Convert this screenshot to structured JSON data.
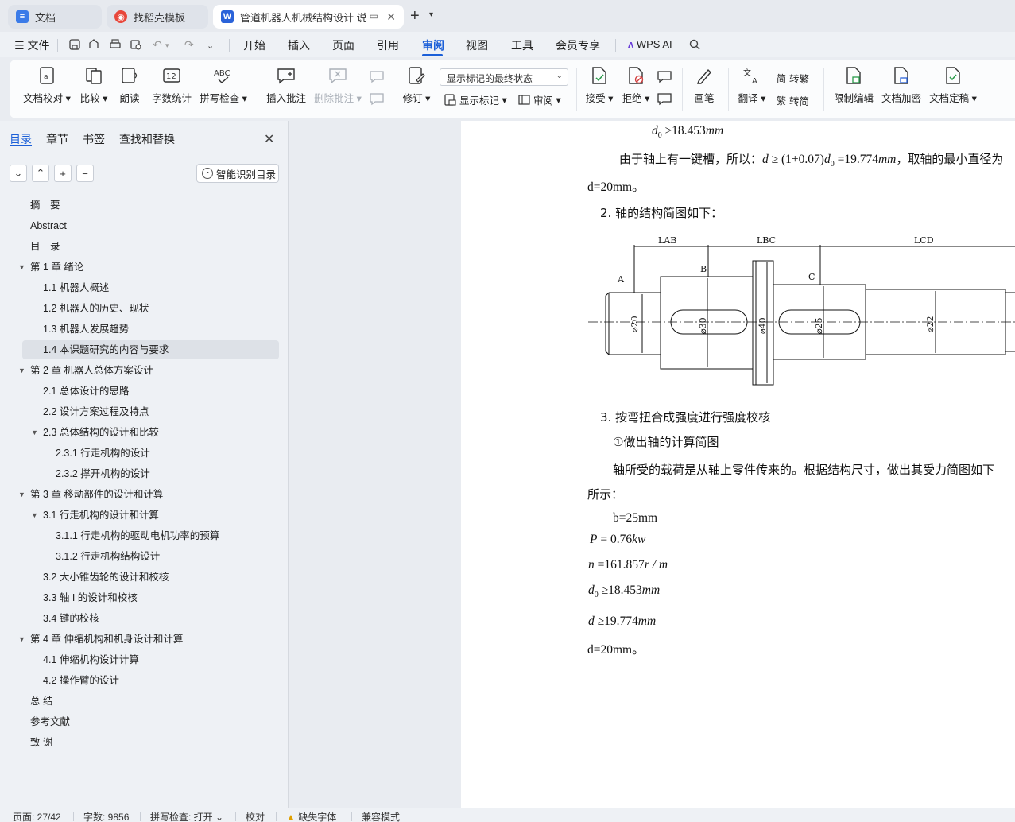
{
  "tabs": [
    {
      "label": "文档",
      "icon": "docs-icon",
      "color": "#3b7be8"
    },
    {
      "label": "找稻壳模板",
      "icon": "docer-icon",
      "color": "#e8473b"
    },
    {
      "label": "管道机器人机械结构设计 说明",
      "icon": "word-icon",
      "color": "#2b63d9"
    }
  ],
  "menu": {
    "file": "文件",
    "items": [
      "开始",
      "插入",
      "页面",
      "引用",
      "审阅",
      "视图",
      "工具",
      "会员专享"
    ],
    "active": "审阅",
    "wps_ai": "WPS AI"
  },
  "ribbon": {
    "proofread": "文档校对",
    "compare": "比较",
    "read_aloud": "朗读",
    "word_count": "字数统计",
    "spell_check": "拼写检查",
    "insert_comment": "插入批注",
    "delete_comment": "删除批注",
    "revise": "修订",
    "markup_state": "显示标记的最终状态",
    "show_markup": "显示标记",
    "review": "审阅",
    "accept": "接受",
    "reject": "拒绝",
    "ink": "画笔",
    "translate": "翻译",
    "to_traditional": "转繁",
    "to_simplified": "转简",
    "restrict_edit": "限制编辑",
    "encrypt": "文档加密",
    "finalize": "文档定稿"
  },
  "nav": {
    "tabs": [
      "目录",
      "章节",
      "书签",
      "查找和替换"
    ],
    "smart_button": "智能识别目录",
    "toc": [
      {
        "label": "摘　要",
        "level": 0,
        "arrow": false
      },
      {
        "label": "Abstract",
        "level": 0,
        "arrow": false
      },
      {
        "label": "目　录",
        "level": 0,
        "arrow": false
      },
      {
        "label": "第 1 章  绪论",
        "level": 0,
        "arrow": true
      },
      {
        "label": "1.1  机器人概述",
        "level": 1,
        "arrow": false
      },
      {
        "label": "1.2  机器人的历史、现状",
        "level": 1,
        "arrow": false
      },
      {
        "label": "1.3 机器人发展趋势",
        "level": 1,
        "arrow": false
      },
      {
        "label": "1.4  本课题研究的内容与要求",
        "level": 1,
        "arrow": false,
        "selected": true
      },
      {
        "label": "第 2 章  机器人总体方案设计",
        "level": 0,
        "arrow": true
      },
      {
        "label": "2.1 总体设计的思路",
        "level": 1,
        "arrow": false
      },
      {
        "label": "2.2  设计方案过程及特点",
        "level": 1,
        "arrow": false
      },
      {
        "label": "2.3  总体结构的设计和比较",
        "level": 1,
        "arrow": true
      },
      {
        "label": "2.3.1  行走机构的设计",
        "level": 2,
        "arrow": false
      },
      {
        "label": "2.3.2  撑开机构的设计",
        "level": 2,
        "arrow": false
      },
      {
        "label": "第 3 章  移动部件的设计和计算",
        "level": 0,
        "arrow": true
      },
      {
        "label": "3.1  行走机构的设计和计算",
        "level": 1,
        "arrow": true
      },
      {
        "label": "3.1.1  行走机构的驱动电机功率的预算",
        "level": 2,
        "arrow": false
      },
      {
        "label": "3.1.2  行走机构结构设计",
        "level": 2,
        "arrow": false
      },
      {
        "label": "3.2 大小锥齿轮的设计和校核",
        "level": 1,
        "arrow": false
      },
      {
        "label": "3.3  轴 I 的设计和校核",
        "level": 1,
        "arrow": false
      },
      {
        "label": "3.4  键的校核",
        "level": 1,
        "arrow": false
      },
      {
        "label": "第 4 章  伸缩机构和机身设计和计算",
        "level": 0,
        "arrow": true
      },
      {
        "label": "4.1  伸缩机构设计计算",
        "level": 1,
        "arrow": false
      },
      {
        "label": "4.2  操作臂的设计",
        "level": 1,
        "arrow": false
      },
      {
        "label": "总 结",
        "level": 0,
        "arrow": false
      },
      {
        "label": "参考文献",
        "level": 0,
        "arrow": false
      },
      {
        "label": "致 谢",
        "level": 0,
        "arrow": false
      }
    ]
  },
  "doc": {
    "line_d0": "≥18.453",
    "line_keyway_pre": "由于轴上有一键槽，所以：",
    "line_keyway_formula_a": "≥ (1+0.07)",
    "line_keyway_formula_b": "=19.774",
    "line_keyway_post": "，取轴的最小直径为",
    "line_d20": "d=20mm。",
    "item2": "2.  轴的结构简图如下：",
    "diagram": {
      "labels_top": [
        "LAB",
        "LBC",
        "LCD"
      ],
      "points": [
        "A",
        "B",
        "C"
      ],
      "diameters": [
        "⌀20",
        "⌀30",
        "⌀40",
        "⌀25",
        "⌀22"
      ]
    },
    "item3": "3.  按弯扭合成强度进行强度校核",
    "sub1": "①做出轴的计算简图",
    "para1": "轴所受的载荷是从轴上零件传来的。根据结构尺寸，做出其受力简图如下",
    "para1b": "所示：",
    "b_val": "b=25mm",
    "p_val": "= 0.76",
    "p_unit": "kw",
    "n_val": "=161.857",
    "n_unit": "r / m",
    "d0_val": "≥18.453",
    "d_val": "≥19.774",
    "d_final": "d=20mm。",
    "mm": "mm"
  },
  "status": {
    "page": "页面: 27/42",
    "words": "字数: 9856",
    "spell": "拼写检查: 打开",
    "proof": "校对",
    "missing_font": "缺失字体",
    "compat": "兼容模式"
  }
}
